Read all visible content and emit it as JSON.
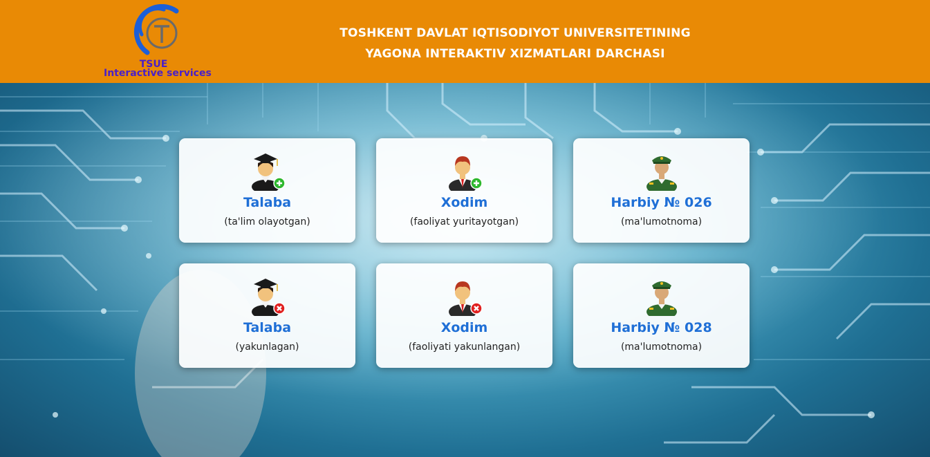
{
  "header": {
    "logo_text": "TSUE",
    "logo_subtitle": "Interactive services",
    "title_line1": "TOSHKENT DAVLAT IQTISODIYOT UNIVERSITETINING",
    "title_line2": "YAGONA INTERAKTIV XIZMATLARI DARCHASI"
  },
  "colors": {
    "header_bg": "#e98a05",
    "card_title": "#1f6fd6",
    "logo_text": "#4a20c8",
    "badge_add": "#2eb82e",
    "badge_remove": "#e02020"
  },
  "cards": [
    {
      "title": "Talaba",
      "subtitle": "(ta'lim olayotgan)",
      "icon": "graduate-add-icon"
    },
    {
      "title": "Xodim",
      "subtitle": "(faoliyat yuritayotgan)",
      "icon": "employee-add-icon"
    },
    {
      "title": "Harbiy № 026",
      "subtitle": "(ma'lumotnoma)",
      "icon": "military-officer-icon"
    },
    {
      "title": "Talaba",
      "subtitle": "(yakunlagan)",
      "icon": "graduate-remove-icon"
    },
    {
      "title": "Xodim",
      "subtitle": "(faoliyati yakunlangan)",
      "icon": "employee-remove-icon"
    },
    {
      "title": "Harbiy № 028",
      "subtitle": "(ma'lumotnoma)",
      "icon": "military-officer-icon"
    }
  ]
}
